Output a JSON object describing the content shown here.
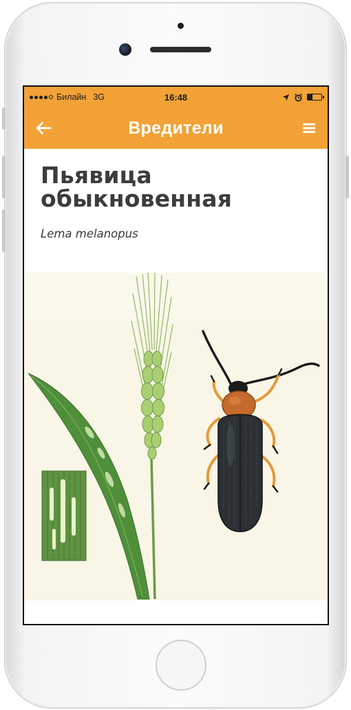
{
  "status_bar": {
    "carrier": "Билайн",
    "network": "3G",
    "time": "16:48",
    "signal_filled": 4,
    "signal_total": 5,
    "battery_level": 0.35
  },
  "nav": {
    "title": "Вредители",
    "back_icon": "arrow-left-icon",
    "menu_icon": "menu-icon",
    "color": "#f2a236"
  },
  "pest": {
    "name": "Пьявица обыкновенная",
    "latin_name": "Lema melanopus"
  }
}
